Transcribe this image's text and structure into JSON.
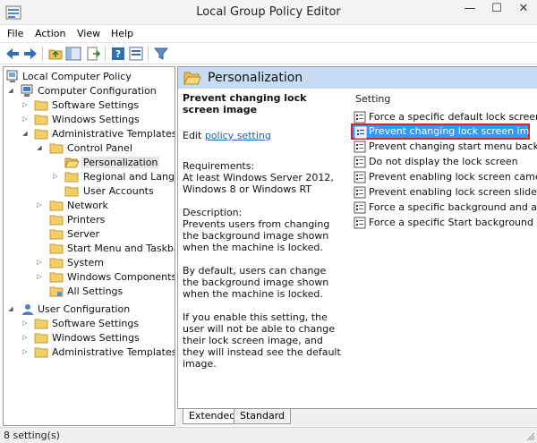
{
  "window": {
    "title": "Local Group Policy Editor",
    "controls": {
      "minimize": "—",
      "maximize": "☐",
      "close": "✕"
    }
  },
  "menu": [
    "File",
    "Action",
    "View",
    "Help"
  ],
  "tree": {
    "items": [
      {
        "label": "Local Computer Policy",
        "icon": "computer-icon"
      },
      {
        "label": "Computer Configuration",
        "icon": "computer-config-icon"
      },
      {
        "label": "Software Settings",
        "icon": "folder-icon"
      },
      {
        "label": "Windows Settings",
        "icon": "folder-icon"
      },
      {
        "label": "Administrative Templates",
        "icon": "folder-icon"
      },
      {
        "label": "Control Panel",
        "icon": "folder-icon"
      },
      {
        "label": "Personalization",
        "icon": "folder-open-icon"
      },
      {
        "label": "Regional and Langua",
        "icon": "folder-icon"
      },
      {
        "label": "User Accounts",
        "icon": "folder-icon"
      },
      {
        "label": "Network",
        "icon": "folder-icon"
      },
      {
        "label": "Printers",
        "icon": "folder-icon"
      },
      {
        "label": "Server",
        "icon": "folder-icon"
      },
      {
        "label": "Start Menu and Taskbar",
        "icon": "folder-icon"
      },
      {
        "label": "System",
        "icon": "folder-icon"
      },
      {
        "label": "Windows Components",
        "icon": "folder-icon"
      },
      {
        "label": "All Settings",
        "icon": "settings-folder-icon"
      },
      {
        "label": "User Configuration",
        "icon": "user-config-icon"
      },
      {
        "label": "Software Settings",
        "icon": "folder-icon"
      },
      {
        "label": "Windows Settings",
        "icon": "folder-icon"
      },
      {
        "label": "Administrative Templates",
        "icon": "folder-icon"
      }
    ]
  },
  "details": {
    "header_title": "Personalization",
    "policy_title": "Prevent changing lock screen image",
    "edit_prefix": "Edit ",
    "edit_link": "policy setting",
    "requirements": "Requirements:\nAt least Windows Server 2012, Windows 8 or Windows RT",
    "description": "Description:\nPrevents users from changing the background image shown when the machine is locked.",
    "default_text": "By default, users can change the background image shown when the machine is locked.",
    "enable_text": "If you enable this setting, the user will not be able to change their lock screen image, and they will instead see the default image."
  },
  "settings_list": {
    "column_header": "Setting",
    "rows": [
      "Force a specific default lock screen ima",
      "Prevent changing lock screen image",
      "Prevent changing start menu backgrou",
      "Do not display the lock screen",
      "Prevent enabling lock screen camera",
      "Prevent enabling lock screen slide show",
      "Force a specific background and accen",
      "Force a specific Start background"
    ],
    "selected_index": 1
  },
  "tabs": [
    "Extended",
    "Standard"
  ],
  "status": {
    "text": "8 setting(s)"
  }
}
